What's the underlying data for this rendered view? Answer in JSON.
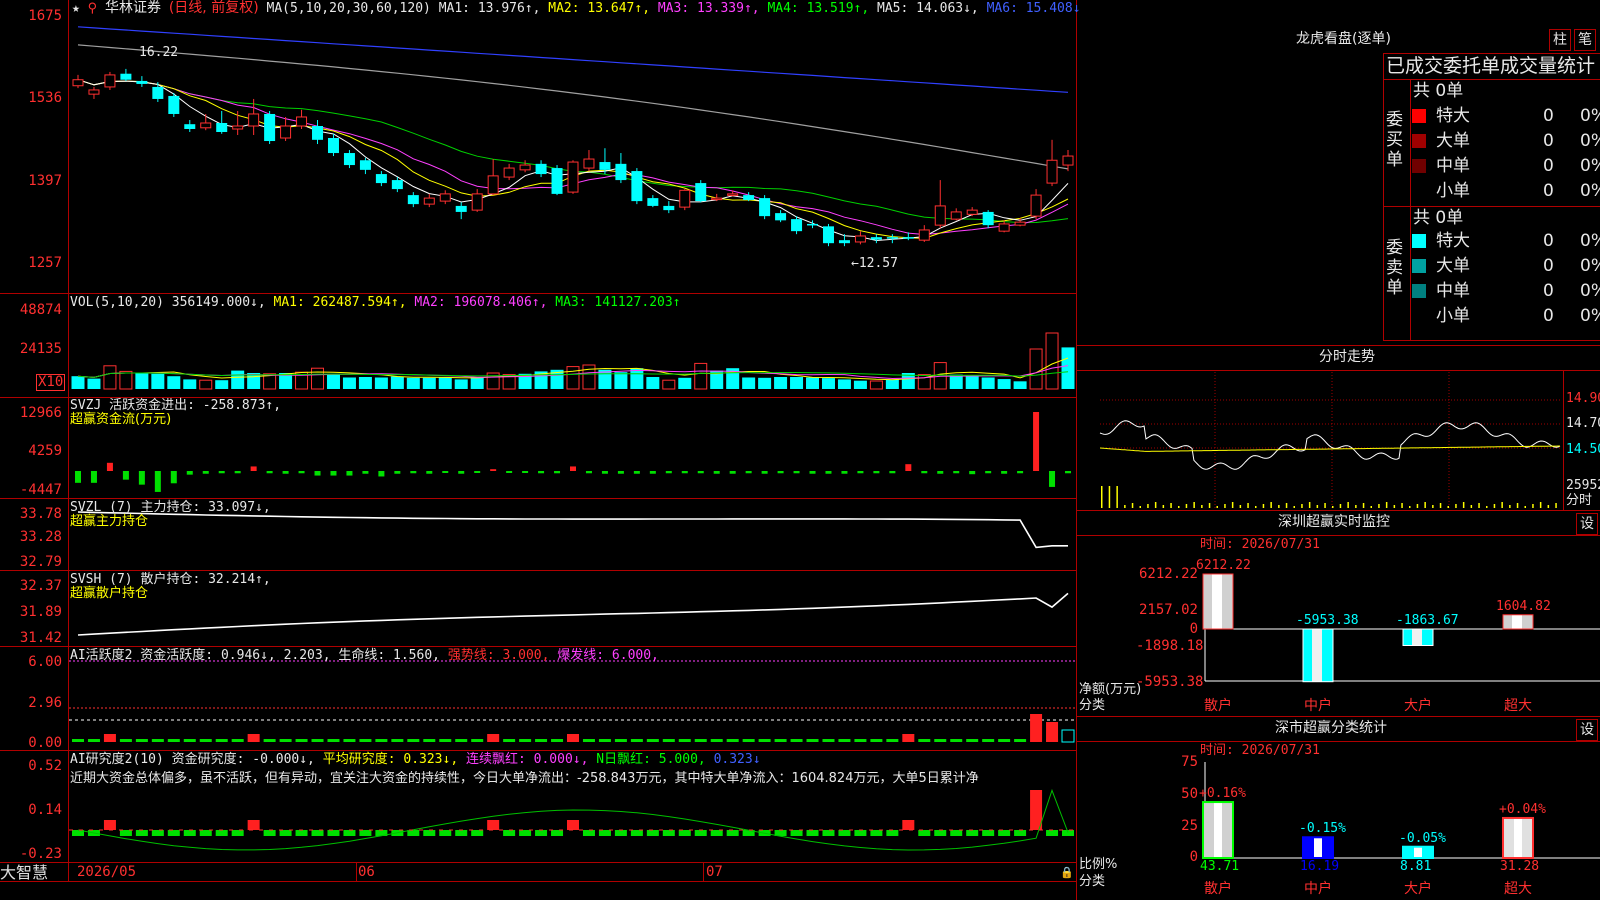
{
  "stock": {
    "name": "华林证券",
    "period": "(日线, 前复权)"
  },
  "ma": {
    "params": "MA(5,10,20,30,60,120)",
    "ma1": "MA1: 13.976↑,",
    "ma2": "MA2: 13.647↑,",
    "ma3": "MA3: 13.339↑,",
    "ma4": "MA4: 13.519↑,",
    "ma5": "MA5: 14.063↓,",
    "ma6": "MA6: 15.408↓"
  },
  "price_axis": [
    "1675",
    "1536",
    "1397",
    "1257"
  ],
  "price_high": "16.22",
  "price_low": "←12.57",
  "vol": {
    "header": "VOL(5,10,20)",
    "value": "356149.000↓,",
    "ma1": "MA1: 262487.594↑,",
    "ma2": "MA2: 196078.406↑,",
    "ma3": "MA3: 141127.203↑",
    "axis": [
      "48874",
      "24135"
    ],
    "unit": "X10"
  },
  "svzj": {
    "header": "SVZJ  活跃资金进出: -258.873↑,",
    "label": "超赢资金流(万元)",
    "axis": [
      "12966",
      "4259",
      "-4447"
    ]
  },
  "svzl": {
    "header": "SVZL (7) 主力持仓: 33.097↓,",
    "label": "超赢主力持仓",
    "axis": [
      "33.78",
      "33.28",
      "32.79"
    ]
  },
  "svsh": {
    "header": "SVSH (7) 散户持仓: 32.214↑,",
    "label": "超赢散户持仓",
    "axis": [
      "32.37",
      "31.89",
      "31.42"
    ]
  },
  "ai1": {
    "header": "AI活跃度2 资金活跃度: 0.946↓, 2.203, 生命线: 1.560,",
    "strong": "强势线: 3.000,",
    "burst": "爆发线: 6.000,",
    "axis": [
      "6.00",
      "2.96",
      "0.00"
    ]
  },
  "ai2": {
    "header": "AI研究度2(10) 资金研究度: -0.000↓,",
    "avg": "平均研究度: 0.323↓,",
    "cont": "连续飘红: 0.000↓,",
    "ndays": "N日飘红: 5.000,",
    "last": "0.323↓",
    "comment": "近期大资金总体偏多，虽不活跃，但有异动，宜关注大资金的持续性，今日大单净流出：-258.843万元，其中特大单净流入：1604.824万元，大单5日累计净",
    "axis": [
      "0.52",
      "0.14",
      "-0.23"
    ]
  },
  "xaxis": {
    "start": "2026/05",
    "jun": "06",
    "jul": "07"
  },
  "brand": "大智慧",
  "right": {
    "lhb_title": "龙虎看盘(逐单)",
    "btn_wang": "柱",
    "btn_bi": "笔",
    "table_header": "已成交委托单成交量统计",
    "buy_label": "委买单",
    "sell_label": "委卖单",
    "buy_total": "共 0单",
    "sell_total": "共 0单",
    "buy_rows": [
      {
        "label": "特大",
        "count": "0",
        "pct": "0%",
        "color": "#ff0000"
      },
      {
        "label": "大单",
        "count": "0",
        "pct": "0%",
        "color": "#a00000"
      },
      {
        "label": "中单",
        "count": "0",
        "pct": "0%",
        "color": "#700000"
      },
      {
        "label": "小单",
        "count": "0",
        "pct": "0%",
        "color": ""
      }
    ],
    "sell_rows": [
      {
        "label": "特大",
        "count": "0",
        "pct": "0%",
        "color": "#00ffff"
      },
      {
        "label": "大单",
        "count": "0",
        "pct": "0%",
        "color": "#00a0a0"
      },
      {
        "label": "中单",
        "count": "0",
        "pct": "0%",
        "color": "#008080"
      },
      {
        "label": "小单",
        "count": "0",
        "pct": "0%",
        "color": ""
      }
    ],
    "intraday_title": "分时走势",
    "intraday_axis": [
      "14.90",
      "14.70",
      "14.50",
      "25952",
      "分时"
    ],
    "monitor_title": "深圳超赢实时监控",
    "monitor_btn": "设",
    "monitor_time": "时间: 2026/07/31",
    "monitor_axis": [
      "6212.22",
      "2157.02",
      "0",
      "-1898.18",
      "-5953.38"
    ],
    "monitor_ylabel": "净额(万元)",
    "monitor_xlabel": "分类",
    "monitor_bars": [
      {
        "cat": "散户",
        "value": 6212.22,
        "label": "6212.22"
      },
      {
        "cat": "中户",
        "value": -5953.38,
        "label": "-5953.38"
      },
      {
        "cat": "大户",
        "value": -1863.67,
        "label": "-1863.67"
      },
      {
        "cat": "超大",
        "value": 1604.82,
        "label": "1604.82"
      }
    ],
    "class_title": "深市超赢分类统计",
    "class_btn": "设",
    "class_time": "时间: 2026/07/31",
    "class_axis": [
      "75",
      "50",
      "25",
      "0"
    ],
    "class_ylabel": "比例%",
    "class_xlabel": "分类",
    "class_bars": [
      {
        "cat": "散户",
        "value": 43.71,
        "label": "43.71",
        "delta": "+0.16%"
      },
      {
        "cat": "中户",
        "value": 16.19,
        "label": "16.19",
        "delta": "-0.15%"
      },
      {
        "cat": "大户",
        "value": 8.81,
        "label": "8.81",
        "delta": "-0.05%"
      },
      {
        "cat": "超大",
        "value": 31.28,
        "label": "31.28",
        "delta": "+0.04%"
      }
    ]
  },
  "candles": [
    [
      15.52,
      15.62,
      15.48,
      15.7
    ],
    [
      15.38,
      15.45,
      15.3,
      15.5
    ],
    [
      15.5,
      15.7,
      15.45,
      15.75
    ],
    [
      15.72,
      15.62,
      15.6,
      15.8
    ],
    [
      15.6,
      15.55,
      15.5,
      15.68
    ],
    [
      15.5,
      15.3,
      15.25,
      15.58
    ],
    [
      15.35,
      15.05,
      15.0,
      15.4
    ],
    [
      14.88,
      14.8,
      14.75,
      14.95
    ],
    [
      14.82,
      14.9,
      14.78,
      15.05
    ],
    [
      14.9,
      14.75,
      14.72,
      15.1
    ],
    [
      14.8,
      14.85,
      14.7,
      15.1
    ],
    [
      14.85,
      15.05,
      14.7,
      15.3
    ],
    [
      15.05,
      14.6,
      14.55,
      15.1
    ],
    [
      14.65,
      14.85,
      14.6,
      15.0
    ],
    [
      14.85,
      15.0,
      14.8,
      15.12
    ],
    [
      14.85,
      14.62,
      14.55,
      14.95
    ],
    [
      14.65,
      14.4,
      14.35,
      14.72
    ],
    [
      14.4,
      14.2,
      14.15,
      14.45
    ],
    [
      14.28,
      14.12,
      14.05,
      14.32
    ],
    [
      14.05,
      13.9,
      13.85,
      14.1
    ],
    [
      13.95,
      13.8,
      13.75,
      14.0
    ],
    [
      13.7,
      13.55,
      13.5,
      13.75
    ],
    [
      13.55,
      13.65,
      13.5,
      13.72
    ],
    [
      13.6,
      13.72,
      13.55,
      13.78
    ],
    [
      13.52,
      13.42,
      13.3,
      13.58
    ],
    [
      13.45,
      13.72,
      13.42,
      13.8
    ],
    [
      13.72,
      14.02,
      13.7,
      14.3
    ],
    [
      14.0,
      14.15,
      13.95,
      14.22
    ],
    [
      14.12,
      14.2,
      14.08,
      14.28
    ],
    [
      14.22,
      14.05,
      14.0,
      14.28
    ],
    [
      14.15,
      13.72,
      13.7,
      14.2
    ],
    [
      13.75,
      14.25,
      13.72,
      14.28
    ],
    [
      14.15,
      14.3,
      14.1,
      14.45
    ],
    [
      14.25,
      14.12,
      14.05,
      14.48
    ],
    [
      14.22,
      13.95,
      13.9,
      14.4
    ],
    [
      14.1,
      13.6,
      13.55,
      14.15
    ],
    [
      13.65,
      13.52,
      13.5,
      13.7
    ],
    [
      13.52,
      13.45,
      13.4,
      13.6
    ],
    [
      13.5,
      13.78,
      13.45,
      13.8
    ],
    [
      13.9,
      13.6,
      13.58,
      13.95
    ],
    [
      13.65,
      13.65,
      13.6,
      13.72
    ],
    [
      13.72,
      13.72,
      13.68,
      13.78
    ],
    [
      13.7,
      13.62,
      13.6,
      13.75
    ],
    [
      13.65,
      13.35,
      13.3,
      13.7
    ],
    [
      13.4,
      13.28,
      13.25,
      13.45
    ],
    [
      13.3,
      13.1,
      13.05,
      13.35
    ],
    [
      13.22,
      13.2,
      13.15,
      13.28
    ],
    [
      13.18,
      12.9,
      12.85,
      13.22
    ],
    [
      12.95,
      12.9,
      12.85,
      13.05
    ],
    [
      12.92,
      13.02,
      12.88,
      13.1
    ],
    [
      13.0,
      12.96,
      12.9,
      13.05
    ],
    [
      13.0,
      12.98,
      12.9,
      13.05
    ],
    [
      13.0,
      12.98,
      12.95,
      13.08
    ],
    [
      12.95,
      13.12,
      12.92,
      13.2
    ],
    [
      13.2,
      13.52,
      13.15,
      13.95
    ],
    [
      13.3,
      13.42,
      13.28,
      13.48
    ],
    [
      13.38,
      13.45,
      13.35,
      13.5
    ],
    [
      13.42,
      13.2,
      13.15,
      13.45
    ],
    [
      13.1,
      13.22,
      13.08,
      13.28
    ],
    [
      13.2,
      13.25,
      13.18,
      13.32
    ],
    [
      13.35,
      13.7,
      13.3,
      13.8
    ],
    [
      13.9,
      14.28,
      13.85,
      14.62
    ],
    [
      14.2,
      14.35,
      14.1,
      14.45
    ]
  ],
  "volumes": [
    [
      8000,
      1
    ],
    [
      6500,
      1
    ],
    [
      14500,
      0
    ],
    [
      11000,
      0
    ],
    [
      10000,
      1
    ],
    [
      9500,
      1
    ],
    [
      8000,
      1
    ],
    [
      6000,
      1
    ],
    [
      5500,
      0
    ],
    [
      5500,
      1
    ],
    [
      11500,
      1
    ],
    [
      10000,
      1
    ],
    [
      9500,
      0
    ],
    [
      10000,
      1
    ],
    [
      10500,
      0
    ],
    [
      13000,
      0
    ],
    [
      9500,
      1
    ],
    [
      7200,
      1
    ],
    [
      7500,
      1
    ],
    [
      7200,
      1
    ],
    [
      7800,
      1
    ],
    [
      7000,
      1
    ],
    [
      7000,
      1
    ],
    [
      7200,
      1
    ],
    [
      6000,
      1
    ],
    [
      7500,
      1
    ],
    [
      10000,
      0
    ],
    [
      9000,
      0
    ],
    [
      9500,
      1
    ],
    [
      11000,
      1
    ],
    [
      12000,
      1
    ],
    [
      14000,
      0
    ],
    [
      15000,
      0
    ],
    [
      12000,
      1
    ],
    [
      10500,
      1
    ],
    [
      13000,
      1
    ],
    [
      7500,
      1
    ],
    [
      5500,
      0
    ],
    [
      7000,
      1
    ],
    [
      16000,
      0
    ],
    [
      11500,
      1
    ],
    [
      13000,
      1
    ],
    [
      7200,
      1
    ],
    [
      7000,
      1
    ],
    [
      7500,
      1
    ],
    [
      7500,
      1
    ],
    [
      7200,
      1
    ],
    [
      6800,
      1
    ],
    [
      6000,
      1
    ],
    [
      5200,
      1
    ],
    [
      5000,
      0
    ],
    [
      6000,
      1
    ],
    [
      10000,
      1
    ],
    [
      9000,
      0
    ],
    [
      16500,
      0
    ],
    [
      9000,
      1
    ],
    [
      7800,
      1
    ],
    [
      7200,
      1
    ],
    [
      6200,
      1
    ],
    [
      4800,
      1
    ],
    [
      25000,
      0
    ],
    [
      35000,
      0
    ],
    [
      26000,
      1
    ]
  ],
  "flows": [
    -2600,
    -2600,
    1800,
    -1900,
    -3000,
    -4600,
    -2700,
    -800,
    -600,
    -500,
    -500,
    1000,
    -500,
    -600,
    -500,
    -1000,
    -1000,
    -1000,
    -600,
    -1200,
    -600,
    -500,
    -600,
    -400,
    -600,
    -400,
    400,
    -400,
    -400,
    -500,
    -500,
    1000,
    -500,
    -600,
    -600,
    -600,
    -600,
    -500,
    -500,
    -500,
    -600,
    -600,
    -500,
    -600,
    -500,
    -500,
    -600,
    -600,
    -600,
    -500,
    -500,
    -500,
    1500,
    -500,
    -600,
    -500,
    -700,
    -500,
    -600,
    -500,
    12966,
    -3500,
    -500
  ]
}
